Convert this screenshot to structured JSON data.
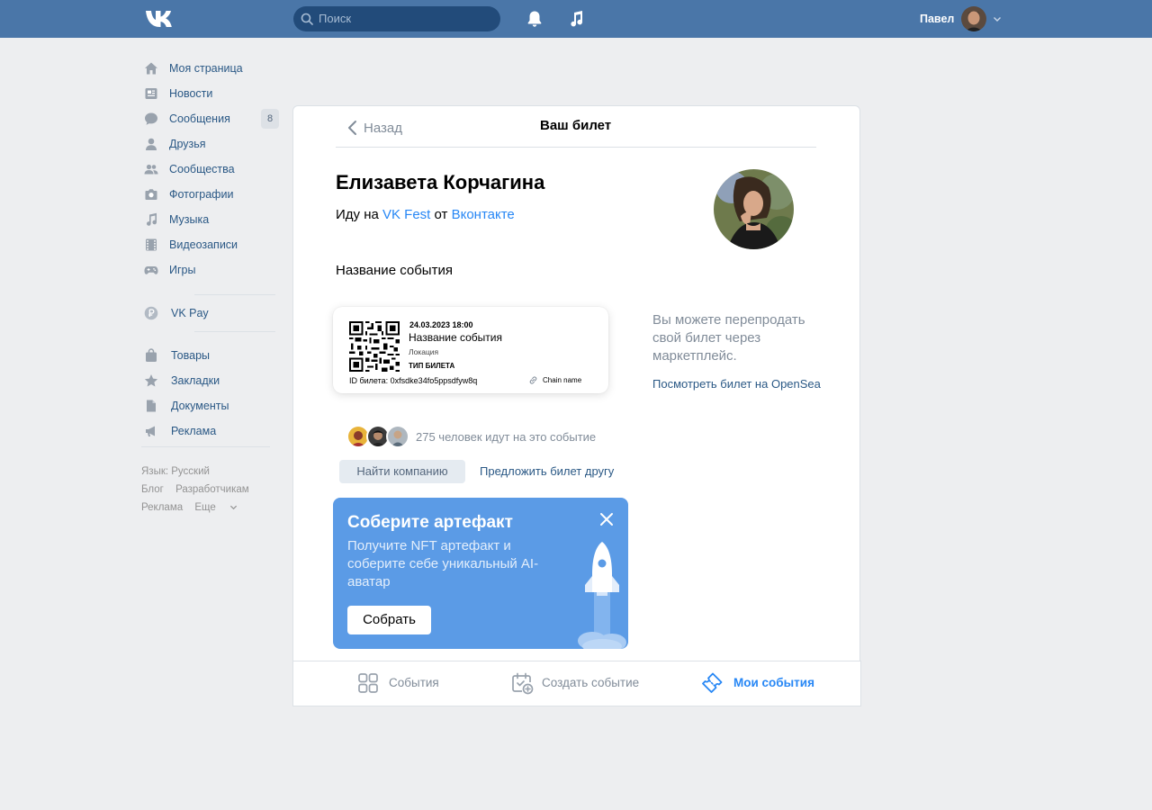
{
  "header": {
    "logo": "VK",
    "search_placeholder": "Поиск",
    "user_name": "Павел",
    "brand_color": "#4a76a8"
  },
  "sidebar": {
    "items": [
      {
        "label": "Моя страница",
        "icon": "home-icon"
      },
      {
        "label": "Новости",
        "icon": "news-icon"
      },
      {
        "label": "Сообщения",
        "icon": "messages-icon",
        "badge": "8"
      },
      {
        "label": "Друзья",
        "icon": "friend-icon"
      },
      {
        "label": "Сообщества",
        "icon": "groups-icon"
      },
      {
        "label": "Фотографии",
        "icon": "camera-icon"
      },
      {
        "label": "Музыка",
        "icon": "music-note-icon"
      },
      {
        "label": "Видеозаписи",
        "icon": "film-icon"
      },
      {
        "label": "Игры",
        "icon": "gamepad-icon"
      }
    ],
    "pay": {
      "label": "VK Pay",
      "icon": "ruble-icon"
    },
    "extra_items": [
      {
        "label": "Товары",
        "icon": "bag-icon"
      },
      {
        "label": "Закладки",
        "icon": "star-icon"
      },
      {
        "label": "Документы",
        "icon": "document-icon"
      },
      {
        "label": "Реклама",
        "icon": "megaphone-icon"
      }
    ],
    "footer": {
      "language": "Язык: Русский",
      "blog": "Блог",
      "developers": "Разработчикам",
      "ads": "Реклама",
      "more": "Еще"
    }
  },
  "ticket_page": {
    "back_label": "Назад",
    "title": "Ваш билет",
    "person_name": "Елизавета Корчагина",
    "going_prefix": "Иду на",
    "event_link": "VK Fest",
    "going_middle": "от",
    "organizer_link": "Вконтакте",
    "event_name": "Название события",
    "ticket": {
      "datetime": "24.03.2023 18:00",
      "name": "Название события",
      "location": "Локация",
      "type": "ТИП БИЛЕТА",
      "id_line": "ID билета: 0xfsdke34fo5ppsdfyw8q",
      "chain": "Chain name"
    },
    "resell_text": "Вы можете перепродать свой билет через маркетплейс.",
    "opensea_link": "Посмотреть билет на OpenSea",
    "attendees_text": "275 человек идут на это событие",
    "find_company_button": "Найти компанию",
    "offer_friend_link": "Предложить билет другу",
    "promo": {
      "title": "Соберите артефакт",
      "text": "Получите NFT артефакт и соберите себе уникальный AI-аватар",
      "button": "Собрать",
      "color": "#5b9be6"
    }
  },
  "bottom_tabs": [
    {
      "label": "События",
      "icon": "grid-icon",
      "active": false
    },
    {
      "label": "Создать событие",
      "icon": "calendar-add-icon",
      "active": false
    },
    {
      "label": "Мои события",
      "icon": "ticket-icon",
      "active": true
    }
  ],
  "colors": {
    "link": "#2a5885",
    "accent_link": "#2787f5",
    "muted": "#818c99",
    "active_tab": "#2787f5"
  }
}
